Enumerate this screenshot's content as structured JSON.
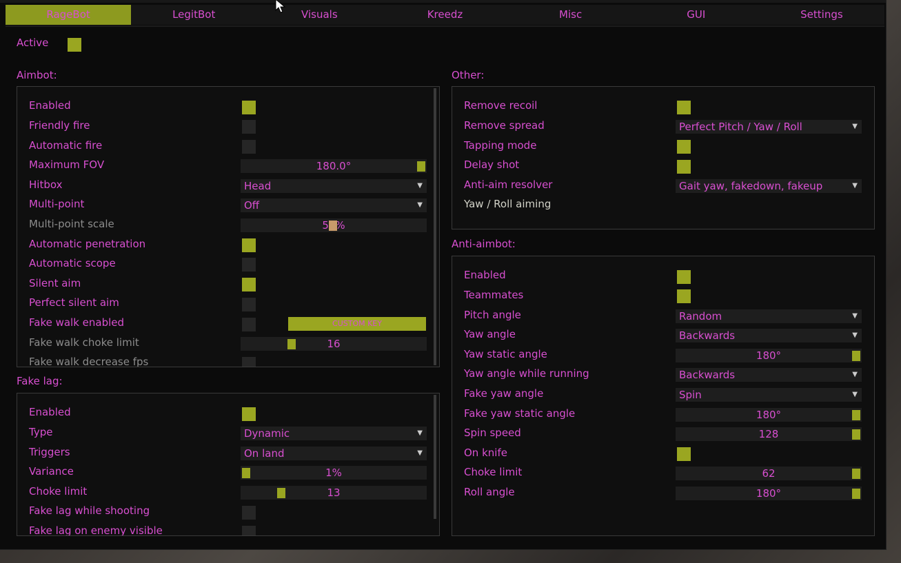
{
  "tabs": [
    "RageBot",
    "LegitBot",
    "Visuals",
    "Kreedz",
    "Misc",
    "GUI",
    "Settings"
  ],
  "active_label": "Active",
  "aimbot": {
    "title": "Aimbot:",
    "enabled": "Enabled",
    "friendly_fire": "Friendly fire",
    "automatic_fire": "Automatic fire",
    "maximum_fov": "Maximum FOV",
    "maximum_fov_value": "180.0°",
    "hitbox": "Hitbox",
    "hitbox_value": "Head",
    "multi_point": "Multi-point",
    "multi_point_value": "Off",
    "multi_point_scale": "Multi-point scale",
    "multi_point_scale_value": "50%",
    "automatic_penetration": "Automatic penetration",
    "automatic_scope": "Automatic scope",
    "silent_aim": "Silent aim",
    "perfect_silent_aim": "Perfect silent aim",
    "fake_walk_enabled": "Fake walk enabled",
    "fake_walk_key": "CUSTOM KEY",
    "fake_walk_choke_limit": "Fake walk choke limit",
    "fake_walk_choke_value": "16",
    "fake_walk_decrease_fps": "Fake walk decrease fps"
  },
  "fakelag": {
    "title": "Fake lag:",
    "enabled": "Enabled",
    "type": "Type",
    "type_value": "Dynamic",
    "triggers": "Triggers",
    "triggers_value": "On land",
    "variance": "Variance",
    "variance_value": "1%",
    "choke_limit": "Choke limit",
    "choke_limit_value": "13",
    "while_shooting": "Fake lag while shooting",
    "on_enemy_visible": "Fake lag on enemy visible"
  },
  "other": {
    "title": "Other:",
    "remove_recoil": "Remove recoil",
    "remove_spread": "Remove spread",
    "remove_spread_value": "Perfect Pitch / Yaw / Roll",
    "tapping_mode": "Tapping mode",
    "delay_shot": "Delay shot",
    "anti_aim_resolver": "Anti-aim resolver",
    "anti_aim_resolver_value": "Gait yaw, fakedown, fakeup",
    "yaw_roll_aiming": "Yaw / Roll aiming"
  },
  "antiaim": {
    "title": "Anti-aimbot:",
    "enabled": "Enabled",
    "teammates": "Teammates",
    "pitch_angle": "Pitch angle",
    "pitch_angle_value": "Random",
    "yaw_angle": "Yaw angle",
    "yaw_angle_value": "Backwards",
    "yaw_static_angle": "Yaw static angle",
    "yaw_static_angle_value": "180°",
    "yaw_angle_running": "Yaw angle while running",
    "yaw_angle_running_value": "Backwards",
    "fake_yaw_angle": "Fake yaw angle",
    "fake_yaw_angle_value": "Spin",
    "fake_yaw_static_angle": "Fake yaw static angle",
    "fake_yaw_static_angle_value": "180°",
    "spin_speed": "Spin speed",
    "spin_speed_value": "128",
    "on_knife": "On knife",
    "choke_limit": "Choke limit",
    "choke_limit_value": "62",
    "roll_angle": "Roll angle",
    "roll_angle_value": "180°"
  },
  "colors": {
    "accent": "#9aa621",
    "text": "#d84fd0",
    "background": "#0b0b0b"
  },
  "icons": {
    "cursor": "mouse-cursor-icon",
    "dropdown": "triangle-down-icon"
  }
}
